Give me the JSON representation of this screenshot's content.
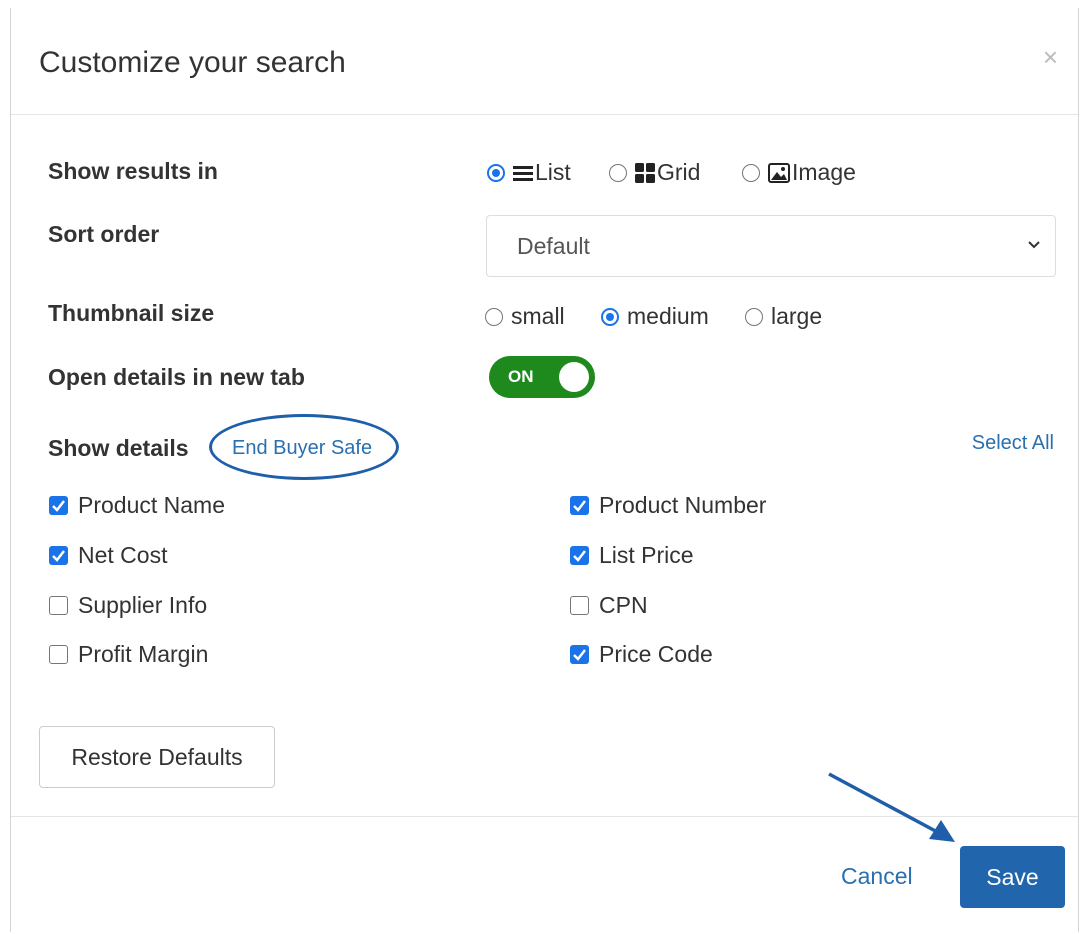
{
  "dialog": {
    "title": "Customize your search",
    "close_label": "×"
  },
  "show_results": {
    "label": "Show results in",
    "options": [
      {
        "label": "List",
        "icon": "list-icon",
        "selected": true
      },
      {
        "label": "Grid",
        "icon": "grid-icon",
        "selected": false
      },
      {
        "label": "Image",
        "icon": "image-icon",
        "selected": false
      }
    ]
  },
  "sort_order": {
    "label": "Sort order",
    "value": "Default"
  },
  "thumbnail_size": {
    "label": "Thumbnail size",
    "options": [
      {
        "label": "small",
        "selected": false
      },
      {
        "label": "medium",
        "selected": true
      },
      {
        "label": "large",
        "selected": false
      }
    ]
  },
  "open_details": {
    "label": "Open details in new tab",
    "toggle_label": "ON",
    "toggle_color": "#1e8a1e"
  },
  "show_details": {
    "label": "Show details",
    "end_buyer_safe": "End Buyer Safe",
    "select_all": "Select All",
    "items": [
      {
        "label": "Product Name",
        "checked": true
      },
      {
        "label": "Product Number",
        "checked": true
      },
      {
        "label": "Net Cost",
        "checked": true
      },
      {
        "label": "List Price",
        "checked": true
      },
      {
        "label": "Supplier Info",
        "checked": false
      },
      {
        "label": "CPN",
        "checked": false
      },
      {
        "label": "Profit Margin",
        "checked": false
      },
      {
        "label": "Price Code",
        "checked": true
      }
    ]
  },
  "footer": {
    "restore_label": "Restore Defaults",
    "cancel_label": "Cancel",
    "save_label": "Save"
  },
  "colors": {
    "accent": "#1a73e8",
    "link": "#2a6fb0",
    "save_button": "#2166ac",
    "annotation": "#1f5ea8"
  }
}
